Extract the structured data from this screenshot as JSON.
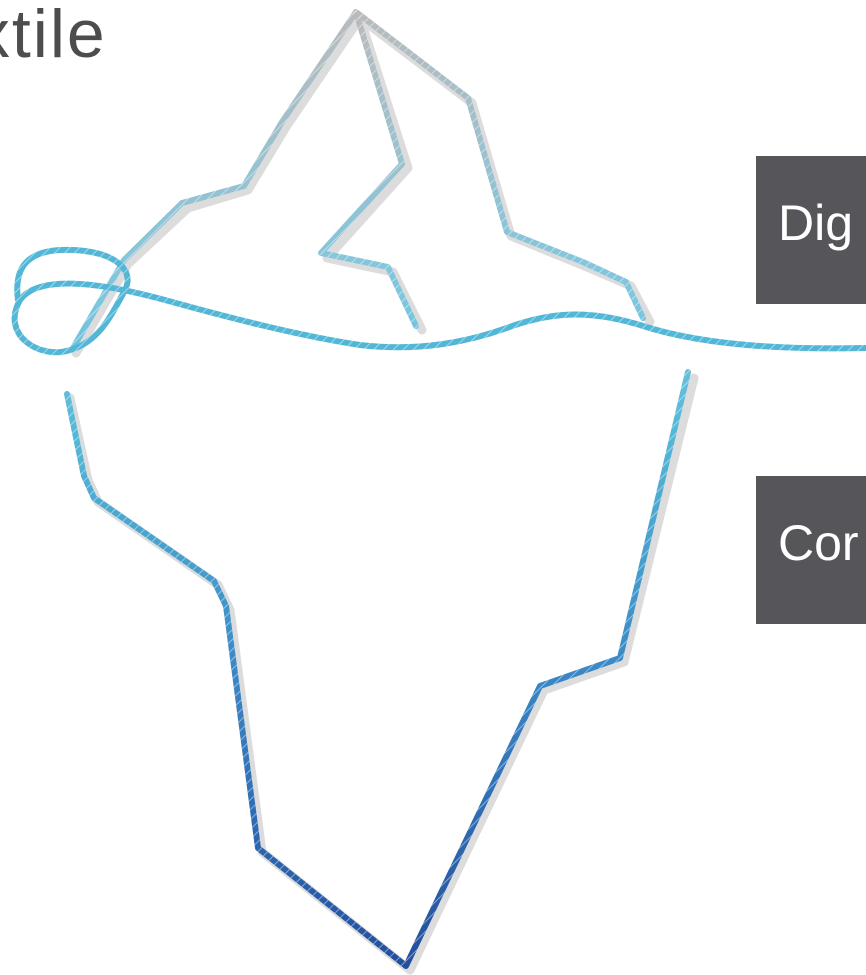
{
  "title": "extile",
  "labels": {
    "above_water": "Dig",
    "below_water": "Cor"
  },
  "colors": {
    "rope_top": "#b9bbbd",
    "rope_mid": "#52b7d6",
    "rope_bottom": "#234f9e",
    "shadow": "#dcdcdc",
    "box_background": "#56565a",
    "title_text": "#4d4d4f"
  },
  "icons": {
    "illustration": "iceberg-rope-icon"
  }
}
